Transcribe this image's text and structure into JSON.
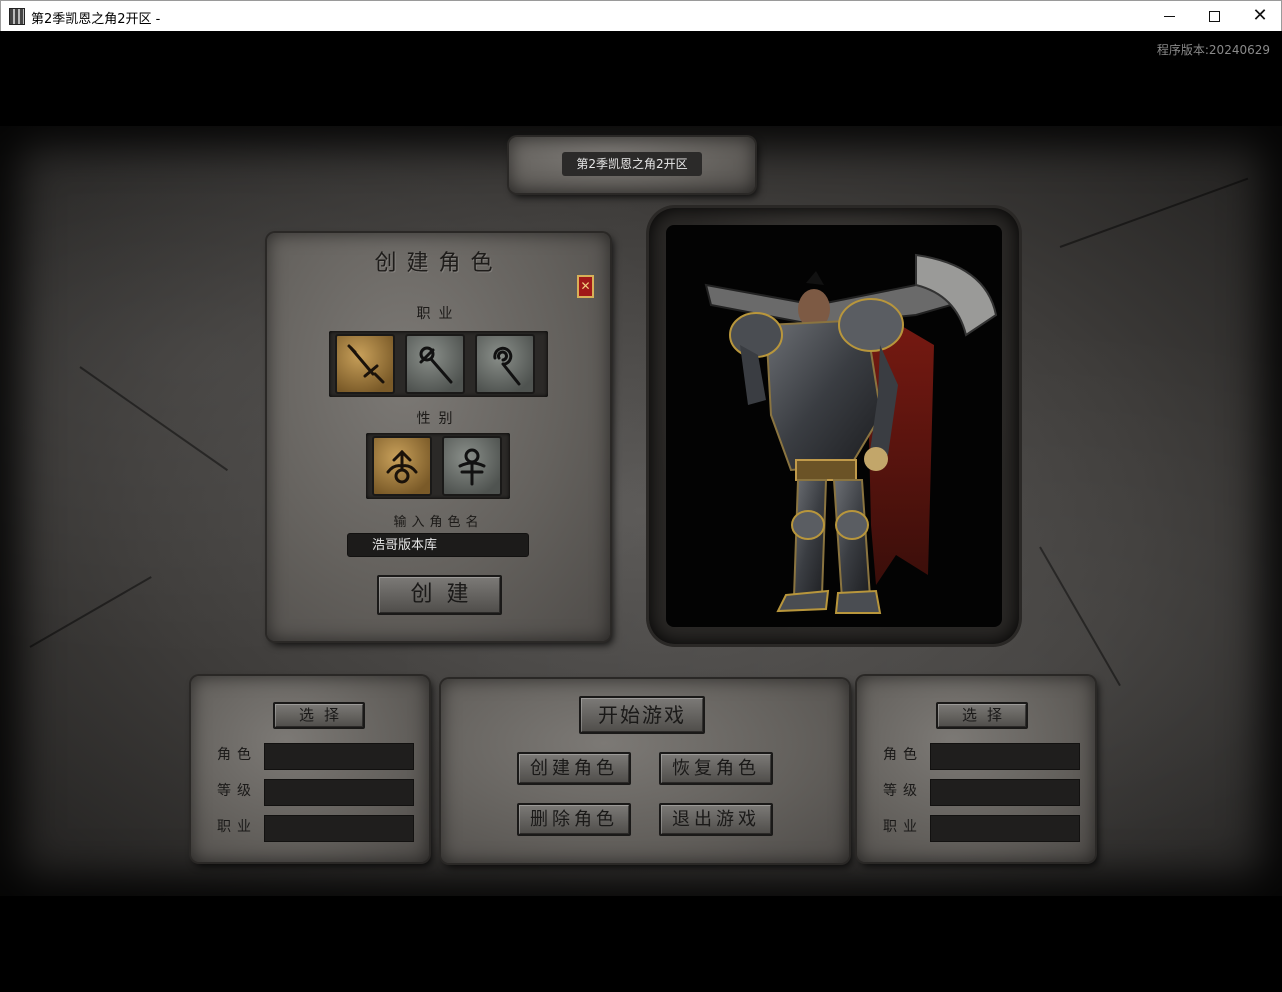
{
  "window": {
    "title": "第2季凯恩之角2开区 -"
  },
  "game": {
    "version_text": "程序版本:20240629",
    "server_name": "第2季凯恩之角2开区"
  },
  "create_panel": {
    "title": "创建角色",
    "close_label": "✕",
    "class_label": "职业",
    "classes": [
      {
        "icon": "sword-icon",
        "selected": true
      },
      {
        "icon": "wand-icon",
        "selected": false
      },
      {
        "icon": "staff-icon",
        "selected": false
      }
    ],
    "gender_label": "性别",
    "genders": [
      {
        "icon": "male-icon",
        "selected": true
      },
      {
        "icon": "female-icon",
        "selected": false
      }
    ],
    "name_label": "输入角色名",
    "name_value": "浩哥版本库",
    "create_button": "创建"
  },
  "left_slot": {
    "select_button": "选择",
    "role_label": "角色",
    "level_label": "等级",
    "class_label": "职业",
    "role_value": "",
    "level_value": "",
    "class_value": ""
  },
  "right_slot": {
    "select_button": "选择",
    "role_label": "角色",
    "level_label": "等级",
    "class_label": "职业",
    "role_value": "",
    "level_value": "",
    "class_value": ""
  },
  "actions": {
    "start_game": "开始游戏",
    "create_character": "创建角色",
    "restore_character": "恢复角色",
    "delete_character": "删除角色",
    "exit_game": "退出游戏"
  },
  "colors": {
    "stone": "#64615d",
    "gold_selected": "#c8a05a",
    "close_red": "#a01818"
  }
}
